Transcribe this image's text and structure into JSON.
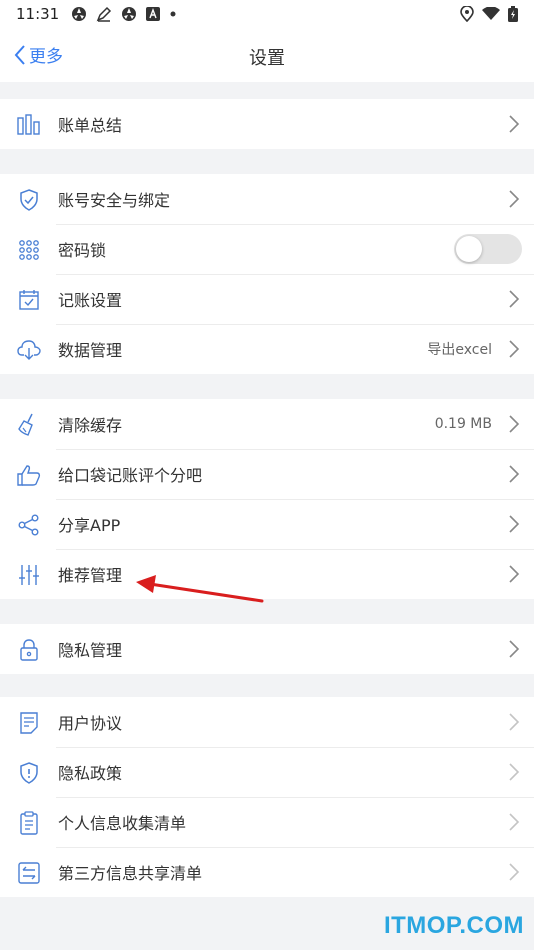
{
  "status_bar": {
    "time": "11:31"
  },
  "nav": {
    "back_label": "更多",
    "title": "设置"
  },
  "groups": {
    "summary": {
      "bill_summary": "账单总结"
    },
    "account": {
      "security": "账号安全与绑定",
      "password_lock": "密码锁",
      "password_lock_enabled": false,
      "bookkeeping": "记账设置",
      "data": "数据管理",
      "data_value": "导出excel"
    },
    "general": {
      "clear_cache": "清除缓存",
      "cache_size": "0.19 MB",
      "rate": "给口袋记账评个分吧",
      "share": "分享APP",
      "recommend": "推荐管理"
    },
    "privacy": {
      "privacy_manage": "隐私管理"
    },
    "legal": {
      "user_agreement": "用户协议",
      "privacy_policy": "隐私政策",
      "personal_info": "个人信息收集清单",
      "third_party": "第三方信息共享清单"
    }
  },
  "watermark": "ITMOP.COM",
  "colors": {
    "accent": "#3b7ff0",
    "annotation_arrow": "#d91e1e",
    "watermark": "#2aa6e0"
  }
}
